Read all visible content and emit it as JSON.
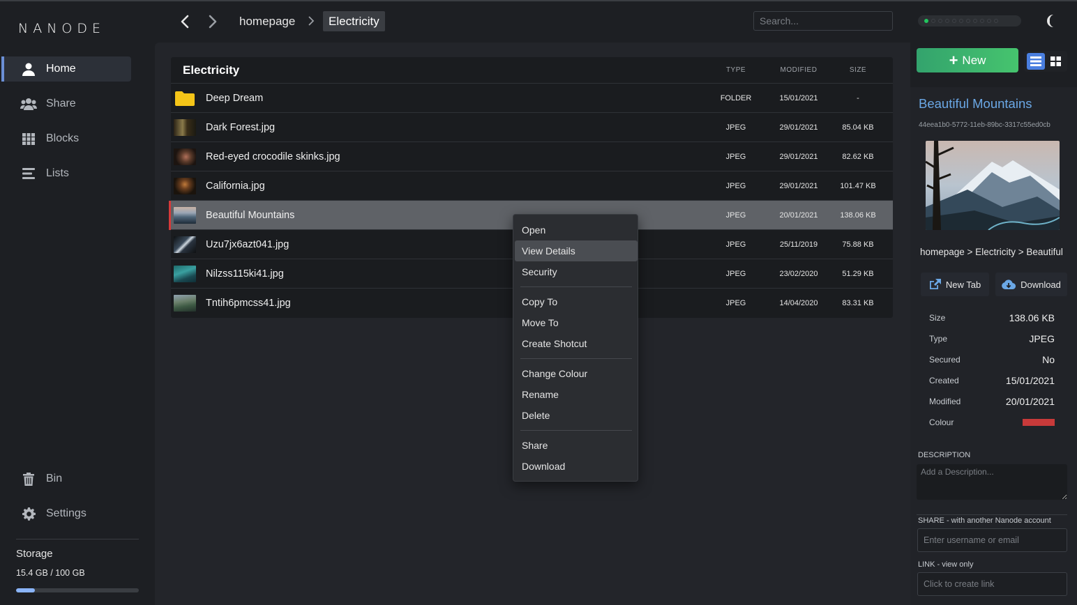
{
  "app": {
    "logo": "NANODE"
  },
  "sidebar": {
    "items": [
      {
        "label": "Home",
        "icon": "user-icon"
      },
      {
        "label": "Share",
        "icon": "users-icon"
      },
      {
        "label": "Blocks",
        "icon": "grid-icon"
      },
      {
        "label": "Lists",
        "icon": "list-icon"
      }
    ],
    "bottom": [
      {
        "label": "Bin",
        "icon": "trash-icon"
      },
      {
        "label": "Settings",
        "icon": "gear-icon"
      }
    ],
    "storage": {
      "label": "Storage",
      "value": "15.4 GB / 100 GB",
      "used_fraction": 0.154
    }
  },
  "topbar": {
    "breadcrumb": [
      "homepage",
      "Electricity"
    ],
    "search_placeholder": "Search...",
    "activity": {
      "total": 11,
      "active": 1
    }
  },
  "table": {
    "title": "Electricity",
    "headers": {
      "type": "TYPE",
      "modified": "MODIFIED",
      "size": "SIZE"
    },
    "rows": [
      {
        "name": "Deep Dream",
        "type": "FOLDER",
        "modified": "15/01/2021",
        "size": "-"
      },
      {
        "name": "Dark Forest.jpg",
        "type": "JPEG",
        "modified": "29/01/2021",
        "size": "85.04 KB"
      },
      {
        "name": "Red-eyed crocodile skinks.jpg",
        "type": "JPEG",
        "modified": "29/01/2021",
        "size": "82.62 KB"
      },
      {
        "name": "California.jpg",
        "type": "JPEG",
        "modified": "29/01/2021",
        "size": "101.47 KB"
      },
      {
        "name": "Beautiful Mountains",
        "type": "JPEG",
        "modified": "20/01/2021",
        "size": "138.06 KB"
      },
      {
        "name": "Uzu7jx6azt041.jpg",
        "type": "JPEG",
        "modified": "25/11/2019",
        "size": "75.88 KB"
      },
      {
        "name": "Nilzss115ki41.jpg",
        "type": "JPEG",
        "modified": "23/02/2020",
        "size": "51.29 KB"
      },
      {
        "name": "Tntih6pmcss41.jpg",
        "type": "JPEG",
        "modified": "14/04/2020",
        "size": "83.31 KB"
      }
    ]
  },
  "context_menu": {
    "items": [
      "Open",
      "View Details",
      "Security",
      "Copy To",
      "Move To",
      "Create Shotcut",
      "Change Colour",
      "Rename",
      "Delete",
      "Share",
      "Download"
    ]
  },
  "toolbar": {
    "new_label": "New"
  },
  "details": {
    "title": "Beautiful Mountains",
    "id": "44eea1b0-5772-11eb-89bc-3317c55ed0cb",
    "path": "homepage > Electricity > Beautiful",
    "new_tab_label": "New Tab",
    "download_label": "Download",
    "props": [
      {
        "key": "Size",
        "value": "138.06 KB"
      },
      {
        "key": "Type",
        "value": "JPEG"
      },
      {
        "key": "Secured",
        "value": "No"
      },
      {
        "key": "Created",
        "value": "15/01/2021"
      },
      {
        "key": "Modified",
        "value": "20/01/2021"
      },
      {
        "key": "Colour",
        "value": ""
      }
    ],
    "colour": "#c83a3a",
    "description_label": "DESCRIPTION",
    "description_placeholder": "Add a Description...",
    "share_label": "SHARE - with another Nanode account",
    "share_placeholder": "Enter username or email",
    "link_label": "LINK - view only",
    "link_placeholder": "Click to create link"
  },
  "colors": {
    "accent": "#6ba8e6",
    "new_button": "#3fb86e",
    "selected_marker": "#d63a3a",
    "view_toggle": "#4a7fe0"
  }
}
